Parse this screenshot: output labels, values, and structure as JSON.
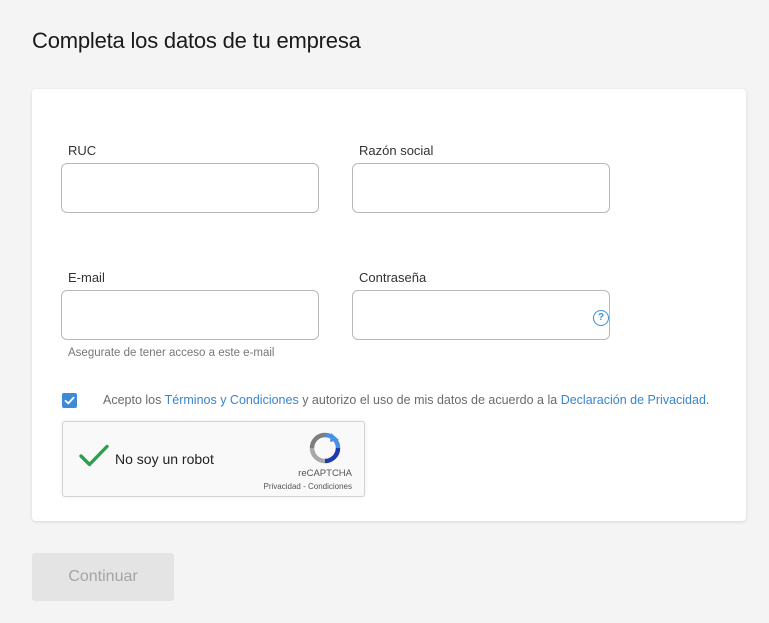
{
  "page": {
    "title": "Completa los datos de tu empresa"
  },
  "form": {
    "ruc": {
      "label": "RUC",
      "value": "",
      "placeholder": ""
    },
    "razon_social": {
      "label": "Razón social",
      "value": "",
      "placeholder": ""
    },
    "email": {
      "label": "E-mail",
      "value": "",
      "placeholder": "",
      "hint": "Asegurate de tener acceso a este e-mail"
    },
    "password": {
      "label": "Contraseña",
      "value": "",
      "placeholder": "",
      "help_icon": "?"
    },
    "terms": {
      "checked": true,
      "text_before": "Acepto los ",
      "link_terms": "Términos y Condiciones",
      "text_middle": " y autorizo el uso de mis datos de acuerdo a la ",
      "link_privacy": "Declaración de Privacidad",
      "text_after": "."
    },
    "recaptcha": {
      "label": "No soy un robot",
      "brand": "reCAPTCHA",
      "privacy_link": "Privacidad",
      "separator": " - ",
      "terms_link": "Condiciones",
      "checked": true
    }
  },
  "actions": {
    "continue_label": "Continuar"
  },
  "colors": {
    "accent": "#3d8ad9",
    "link": "#3a84cf",
    "check_green": "#2e9e4f",
    "disabled_button_bg": "#e4e4e4",
    "disabled_button_text": "#a4a4a4",
    "background": "#f4f4f4"
  },
  "icons": {
    "help": "help-circle-icon",
    "checkbox": "checkmark-icon",
    "recaptcha_check": "green-check-icon",
    "recaptcha_logo": "recaptcha-logo-icon"
  }
}
